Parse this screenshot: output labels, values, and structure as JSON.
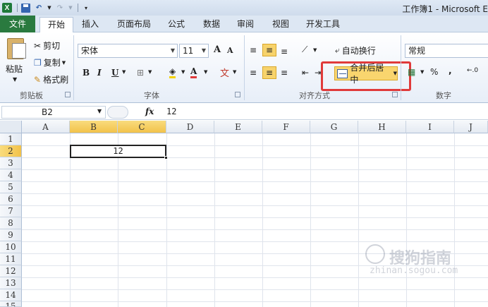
{
  "window": {
    "title": "工作簿1 - Microsoft E"
  },
  "tabs": [
    "文件",
    "开始",
    "插入",
    "页面布局",
    "公式",
    "数据",
    "审阅",
    "视图",
    "开发工具"
  ],
  "clipboard": {
    "paste": "粘贴",
    "cut": "剪切",
    "copy": "复制",
    "format_painter": "格式刷",
    "group_label": "剪贴板"
  },
  "font": {
    "name": "宋体",
    "size": "11",
    "bold": "B",
    "italic": "I",
    "underline": "U",
    "grow": "A",
    "shrink": "A",
    "group_label": "字体",
    "wen": "文"
  },
  "alignment": {
    "wrap_text": "自动换行",
    "merge_center": "合并后居中",
    "group_label": "对齐方式"
  },
  "number": {
    "format": "常规",
    "percent": "%",
    "comma": ",",
    "group_label": "数字"
  },
  "formula_bar": {
    "name_box": "B2",
    "fx": "fx",
    "value": "12"
  },
  "grid": {
    "columns": [
      "A",
      "B",
      "C",
      "D",
      "E",
      "F",
      "G",
      "H",
      "I",
      "J"
    ],
    "rows": [
      "1",
      "2",
      "3",
      "4",
      "5",
      "6",
      "7",
      "8",
      "9",
      "10",
      "11",
      "12",
      "13",
      "14",
      "15"
    ],
    "selected_cell_value": "12"
  },
  "watermark": {
    "main": "搜狗指南",
    "sub": "zhinan.sogou.com"
  },
  "colors": {
    "file_tab": "#2a7a3f",
    "highlight": "#e03a3a",
    "selected_header": "#f2c24a"
  }
}
